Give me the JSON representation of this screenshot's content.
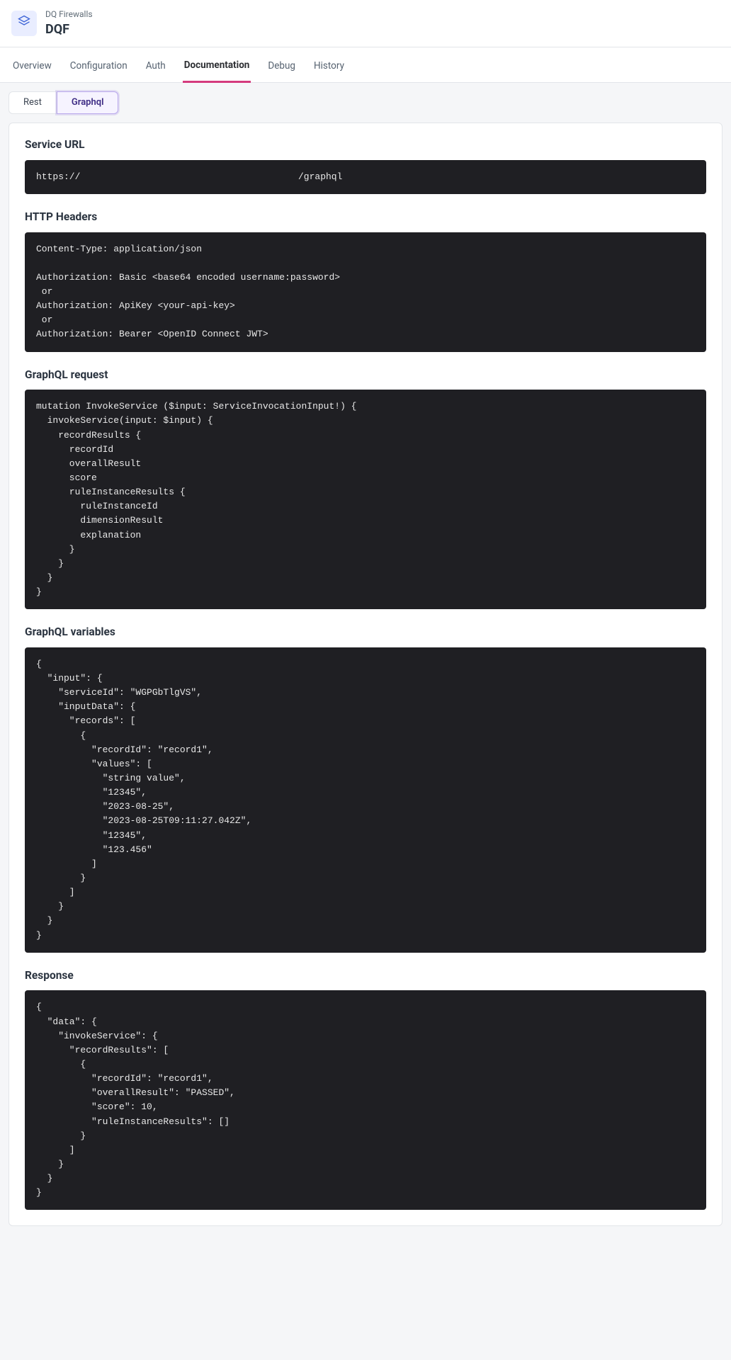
{
  "header": {
    "subtitle": "DQ Firewalls",
    "title": "DQF"
  },
  "tabs": [
    {
      "label": "Overview",
      "active": false
    },
    {
      "label": "Configuration",
      "active": false
    },
    {
      "label": "Auth",
      "active": false
    },
    {
      "label": "Documentation",
      "active": true
    },
    {
      "label": "Debug",
      "active": false
    },
    {
      "label": "History",
      "active": false
    }
  ],
  "subtabs": [
    {
      "label": "Rest",
      "active": false
    },
    {
      "label": "Graphql",
      "active": true
    }
  ],
  "sections": {
    "service_url": {
      "title": "Service URL",
      "prefix": "https://",
      "suffix": "/graphql"
    },
    "http_headers": {
      "title": "HTTP Headers",
      "body": "Content-Type: application/json\n\nAuthorization: Basic <base64 encoded username:password>\n or\nAuthorization: ApiKey <your-api-key>\n or\nAuthorization: Bearer <OpenID Connect JWT>"
    },
    "graphql_request": {
      "title": "GraphQL request",
      "body": "mutation InvokeService ($input: ServiceInvocationInput!) {\n  invokeService(input: $input) {\n    recordResults {\n      recordId\n      overallResult\n      score\n      ruleInstanceResults {\n        ruleInstanceId\n        dimensionResult\n        explanation\n      }\n    }\n  }\n}"
    },
    "graphql_variables": {
      "title": "GraphQL variables",
      "body": "{\n  \"input\": {\n    \"serviceId\": \"WGPGbTlgVS\",\n    \"inputData\": {\n      \"records\": [\n        {\n          \"recordId\": \"record1\",\n          \"values\": [\n            \"string value\",\n            \"12345\",\n            \"2023-08-25\",\n            \"2023-08-25T09:11:27.042Z\",\n            \"12345\",\n            \"123.456\"\n          ]\n        }\n      ]\n    }\n  }\n}"
    },
    "response": {
      "title": "Response",
      "body": "{\n  \"data\": {\n    \"invokeService\": {\n      \"recordResults\": [\n        {\n          \"recordId\": \"record1\",\n          \"overallResult\": \"PASSED\",\n          \"score\": 10,\n          \"ruleInstanceResults\": []\n        }\n      ]\n    }\n  }\n}"
    }
  }
}
